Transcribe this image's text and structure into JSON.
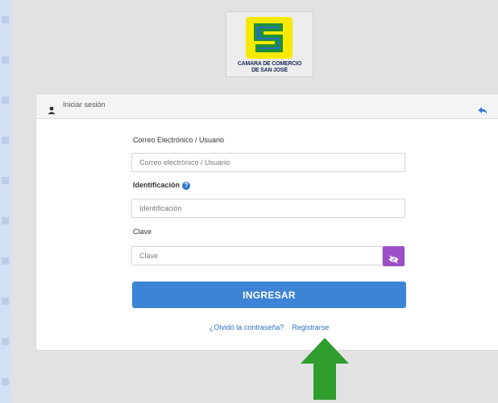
{
  "logo": {
    "line1": "CAMARA DE COMERCIO",
    "line2": "DE SAN JOSE"
  },
  "header": {
    "title": "Iniciar sesión",
    "user_icon": "user-icon",
    "back_icon": "back-arrow-icon"
  },
  "form": {
    "email_label": "Correo Electrónico / Usuario",
    "email_placeholder": "Correo electrónico / Usuario",
    "id_label": "Identificación",
    "id_placeholder": "Identificación",
    "password_label": "Clave",
    "password_placeholder": "Clave",
    "submit_label": "INGRESAR",
    "forgot_link": "¿Olvidó la contraseña?",
    "register_link": "Registrarse"
  },
  "colors": {
    "primary": "#3d84d6",
    "eye_button": "#9b4fc7",
    "arrow": "#2f9e2f",
    "background": "#c9d7ee"
  }
}
